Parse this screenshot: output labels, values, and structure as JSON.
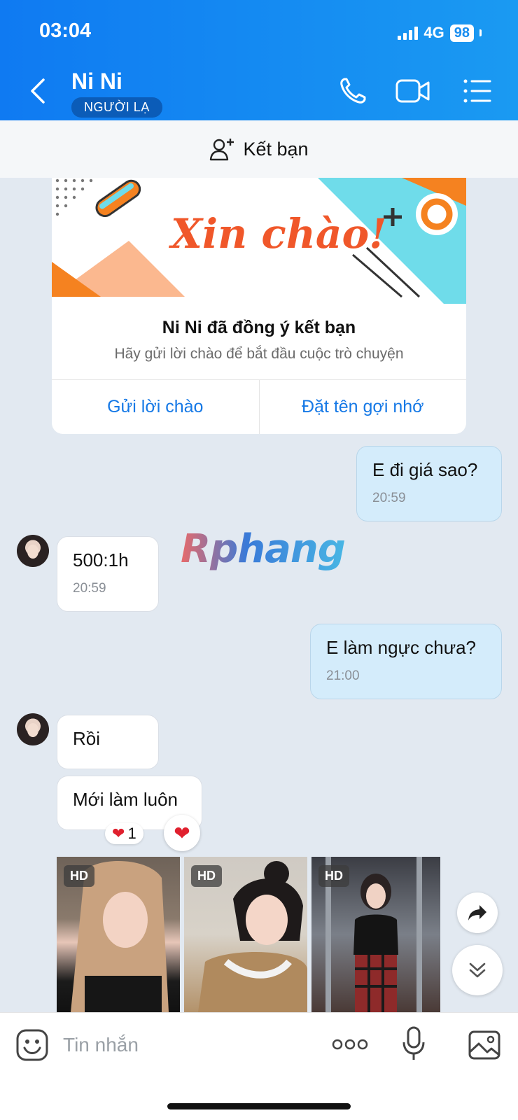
{
  "status_bar": {
    "time": "03:04",
    "network": "4G",
    "battery": "98"
  },
  "header": {
    "contact_name": "Ni Ni",
    "stranger_badge": "NGƯỜI LẠ"
  },
  "add_friend": {
    "label": "Kết bạn"
  },
  "welcome_card": {
    "banner_text": "Xin chào!",
    "title": "Ni Ni đã đồng ý kết bạn",
    "subtitle": "Hãy gửi lời chào để bắt đầu cuộc trò chuyện",
    "button_greet": "Gửi lời chào",
    "button_nickname": "Đặt tên gợi nhớ"
  },
  "messages": [
    {
      "sender": "me",
      "text": "E đi giá sao?",
      "time": "20:59"
    },
    {
      "sender": "them",
      "text": "500:1h",
      "time": "20:59"
    },
    {
      "sender": "me",
      "text": "E làm ngực chưa?",
      "time": "21:00"
    },
    {
      "sender": "them",
      "text": "Rồi"
    },
    {
      "sender": "them",
      "text": "Mới làm luôn",
      "reaction_count": "1"
    }
  ],
  "watermark": "Rphang",
  "photos": [
    {
      "badge": "HD"
    },
    {
      "badge": "HD"
    },
    {
      "badge": "HD"
    }
  ],
  "composer": {
    "placeholder": "Tin nhắn"
  },
  "colors": {
    "header": "#0f7af2",
    "my_bubble": "#d4ecfb",
    "link": "#1679e6",
    "background": "#e2e9f1"
  }
}
